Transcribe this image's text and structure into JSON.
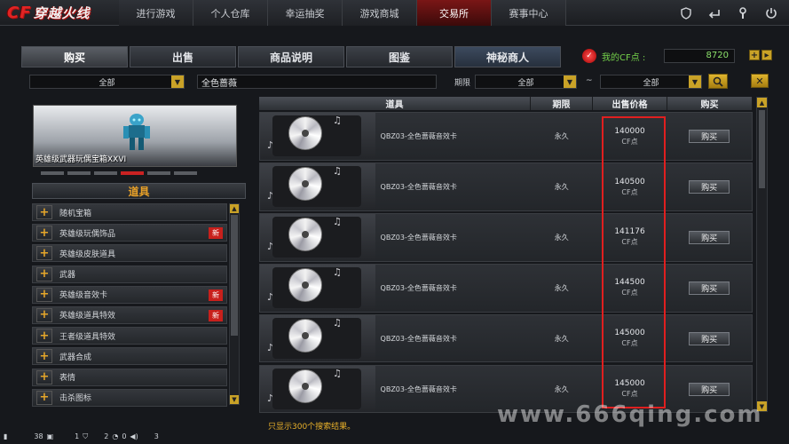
{
  "game": {
    "logo_prefix": "CF",
    "logo_text": "穿越火线"
  },
  "topnav": [
    {
      "label": "进行游戏",
      "active": false
    },
    {
      "label": "个人仓库",
      "active": false
    },
    {
      "label": "幸运抽奖",
      "active": false
    },
    {
      "label": "游戏商城",
      "active": false
    },
    {
      "label": "交易所",
      "active": true
    },
    {
      "label": "赛事中心",
      "active": false
    }
  ],
  "topicons": [
    "shield-icon",
    "return-icon",
    "wrench-icon",
    "power-icon"
  ],
  "tabs": [
    "购买",
    "出售",
    "商品说明",
    "图鉴",
    "神秘商人"
  ],
  "cf": {
    "label": "我的CF点 :",
    "value": "8720"
  },
  "filters": {
    "category": "全部",
    "search": "全色蔷薇",
    "period_label": "期限",
    "from": "全部",
    "tilde": "~",
    "to": "全部"
  },
  "preview": {
    "name": "英雄级武器玩偶宝箱XXVI"
  },
  "category_header": "道具",
  "categories": [
    {
      "label": "随机宝箱",
      "new": false
    },
    {
      "label": "英雄级玩偶饰品",
      "new": true
    },
    {
      "label": "英雄级皮肤道具",
      "new": false
    },
    {
      "label": "武器",
      "new": false
    },
    {
      "label": "英雄级音效卡",
      "new": true
    },
    {
      "label": "英雄级道具特效",
      "new": true
    },
    {
      "label": "王者级道具特效",
      "new": false
    },
    {
      "label": "武器合成",
      "new": false
    },
    {
      "label": "表情",
      "new": false
    },
    {
      "label": "击杀图标",
      "new": false
    }
  ],
  "new_badge": "新",
  "table": {
    "headers": {
      "item": "道具",
      "period": "期限",
      "price": "出售价格",
      "buy": "购买"
    },
    "rows": [
      {
        "name": "QBZ03-全色蔷薇音效卡",
        "period": "永久",
        "price": "140000",
        "unit": "CF点",
        "buy": "购买"
      },
      {
        "name": "QBZ03-全色蔷薇音效卡",
        "period": "永久",
        "price": "140500",
        "unit": "CF点",
        "buy": "购买"
      },
      {
        "name": "QBZ03-全色蔷薇音效卡",
        "period": "永久",
        "price": "141176",
        "unit": "CF点",
        "buy": "购买"
      },
      {
        "name": "QBZ03-全色蔷薇音效卡",
        "period": "永久",
        "price": "144500",
        "unit": "CF点",
        "buy": "购买"
      },
      {
        "name": "QBZ03-全色蔷薇音效卡",
        "period": "永久",
        "price": "145000",
        "unit": "CF点",
        "buy": "购买"
      },
      {
        "name": "QBZ03-全色蔷薇音效卡",
        "period": "永久",
        "price": "145000",
        "unit": "CF点",
        "buy": "购买"
      }
    ]
  },
  "result_note": "只显示300个搜索结果。",
  "watermark": "www.666qing.com",
  "status": {
    "count1": "38",
    "count2": "1",
    "count3": "2",
    "count4": "0",
    "count5": "3"
  }
}
